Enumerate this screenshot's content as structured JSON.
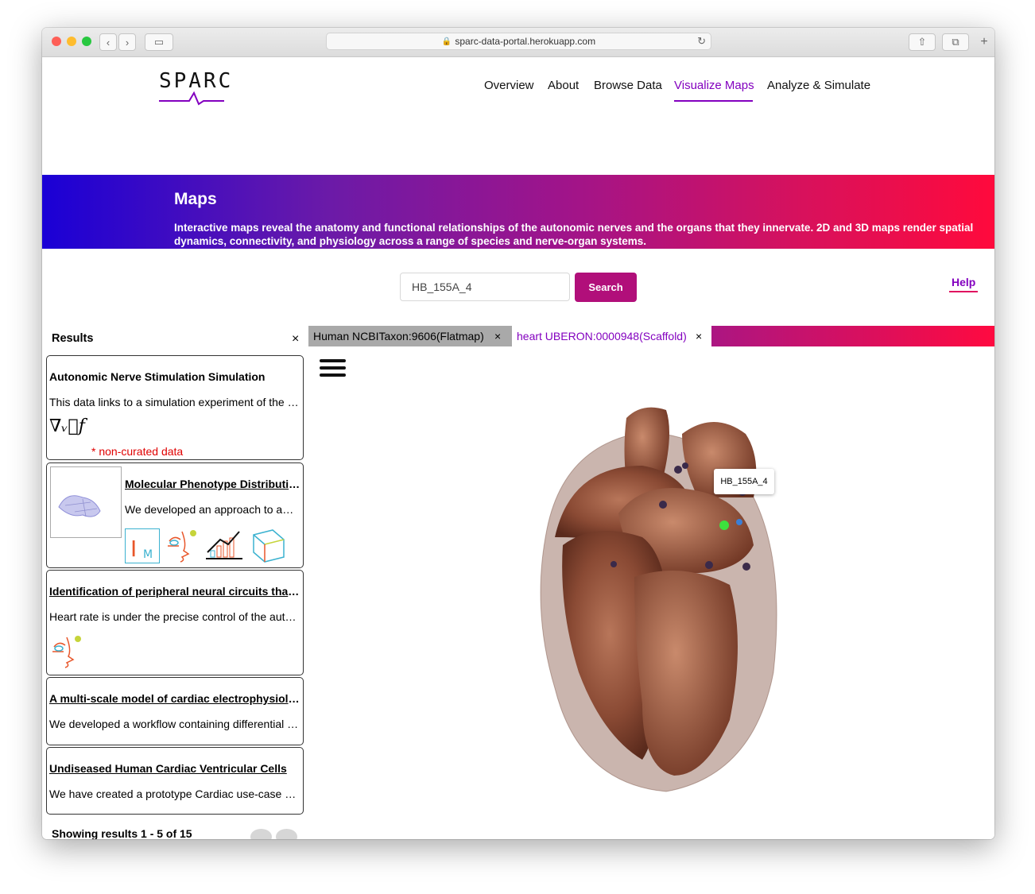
{
  "browser": {
    "url": "sparc-data-portal.herokuapp.com"
  },
  "header": {
    "logo": "SPARC",
    "nav": [
      {
        "label": "Overview"
      },
      {
        "label": "About"
      },
      {
        "label": "Browse Data"
      },
      {
        "label": "Visualize Maps",
        "active": true
      },
      {
        "label": "Analyze & Simulate"
      }
    ]
  },
  "banner": {
    "title": "Maps",
    "description": "Interactive maps reveal the anatomy and functional relationships of the autonomic nerves and the organs that they innervate. 2D and 3D maps render spatial dynamics, connectivity, and physiology across a range of species and nerve-organ systems."
  },
  "search": {
    "value": "HB_155A_4",
    "button_label": "Search",
    "help_label": "Help"
  },
  "results": {
    "title": "Results",
    "close": "×",
    "non_curated": "* non-curated data",
    "items": [
      {
        "title": "Autonomic Nerve Stimulation Simulation",
        "description": "This data links to a simulation experiment of the autonomic nerve stimulation",
        "icon_text": "∇ᵥ⃗f"
      },
      {
        "title": "Molecular Phenotype Distribution of Single Rat Intracardiac Neurons",
        "description": "We developed an approach to analyze the molecular phenotype"
      },
      {
        "title": "Identification of peripheral neural circuits that regulate heart rate",
        "description": "Heart rate is under the precise control of the autonomic nervous system"
      },
      {
        "title": "A multi-scale model of cardiac electrophysiology",
        "description": "We developed a workflow containing differential equations"
      },
      {
        "title": "Undiseased Human Cardiac Ventricular Cells",
        "description": "We have created a prototype Cardiac use-case of the workflow"
      }
    ],
    "showing": "Showing results 1 - 5 of 15"
  },
  "map": {
    "tabs": [
      {
        "label": "Human NCBITaxon:9606(Flatmap)",
        "close": "×"
      },
      {
        "label": "heart UBERON:0000948(Scaffold)",
        "close": "×",
        "active": true
      }
    ],
    "tooltip": "HB_155A_4"
  },
  "colors": {
    "brand_purple": "#8300bf",
    "search_button": "#b10f7a",
    "non_curated": "#e00000"
  }
}
